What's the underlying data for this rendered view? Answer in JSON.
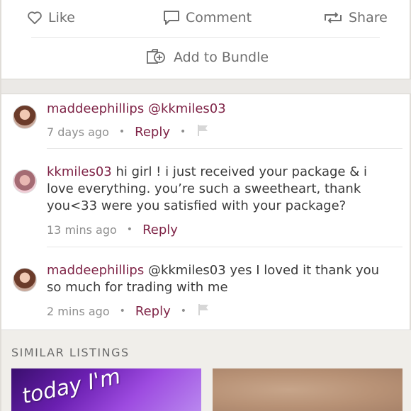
{
  "actions": {
    "like_label": "Like",
    "comment_label": "Comment",
    "share_label": "Share",
    "bundle_label": "Add to Bundle"
  },
  "comments": [
    {
      "username": "maddeephillips",
      "text": "@kkmiles03",
      "time": "7 days ago",
      "reply_label": "Reply",
      "has_flag": true
    },
    {
      "username": "kkmiles03",
      "text": "hi girl ! i just received your package & i love everything. you’re such a sweetheart, thank you<33 were you satisfied with your package?",
      "time": "13 mins ago",
      "reply_label": "Reply",
      "has_flag": false
    },
    {
      "username": "maddeephillips",
      "text": "@kkmiles03 yes I loved it thank you so much for trading with me",
      "time": "2 mins ago",
      "reply_label": "Reply",
      "has_flag": true
    }
  ],
  "similar": {
    "title": "SIMILAR LISTINGS",
    "thumb1_text": "today I'm"
  },
  "colors": {
    "accent": "#7f2447",
    "icon_gray": "#6f6f6f"
  },
  "icons": [
    "heart-icon",
    "comment-bubble-icon",
    "share-icon",
    "bundle-icon",
    "flag-icon"
  ]
}
